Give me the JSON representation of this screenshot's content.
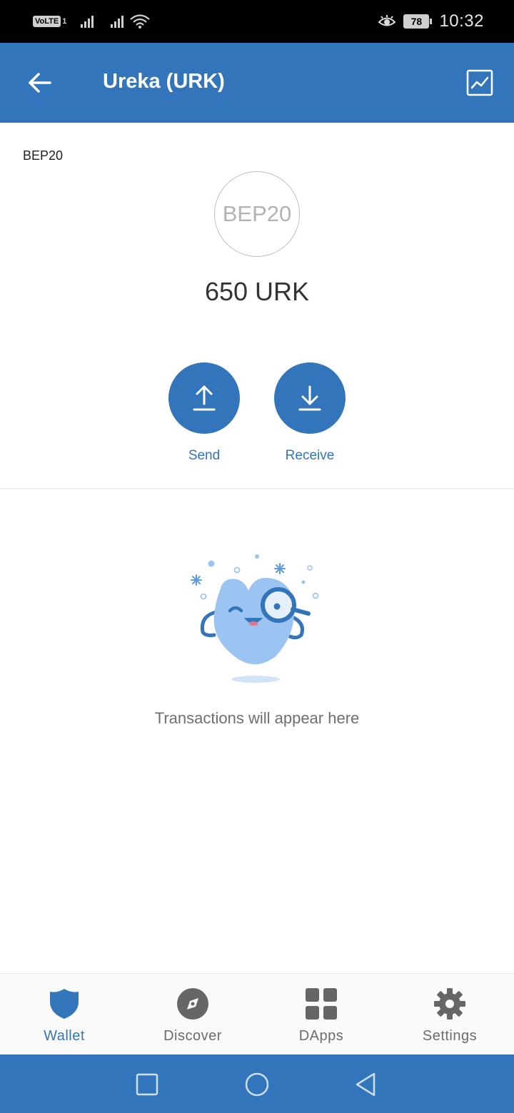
{
  "status_bar": {
    "volte_label": "VoLTE",
    "volte_sub": "1",
    "battery_level": "78",
    "time": "10:32"
  },
  "header": {
    "title": "Ureka (URK)",
    "back_icon": "arrow-left-icon",
    "chart_icon": "price-chart-icon"
  },
  "token": {
    "standard": "BEP20",
    "logo_text": "BEP20",
    "balance": "650 URK"
  },
  "actions": {
    "send_label": "Send",
    "receive_label": "Receive"
  },
  "empty_state": {
    "message": "Transactions will appear here"
  },
  "bottom_nav": {
    "items": [
      {
        "label": "Wallet",
        "icon": "shield-icon",
        "active": true
      },
      {
        "label": "Discover",
        "icon": "compass-icon",
        "active": false
      },
      {
        "label": "DApps",
        "icon": "grid-icon",
        "active": false
      },
      {
        "label": "Settings",
        "icon": "gear-icon",
        "active": false
      }
    ]
  },
  "colors": {
    "primary": "#3375bb",
    "illustration_light": "#9cc4f2",
    "inactive": "#666666"
  }
}
